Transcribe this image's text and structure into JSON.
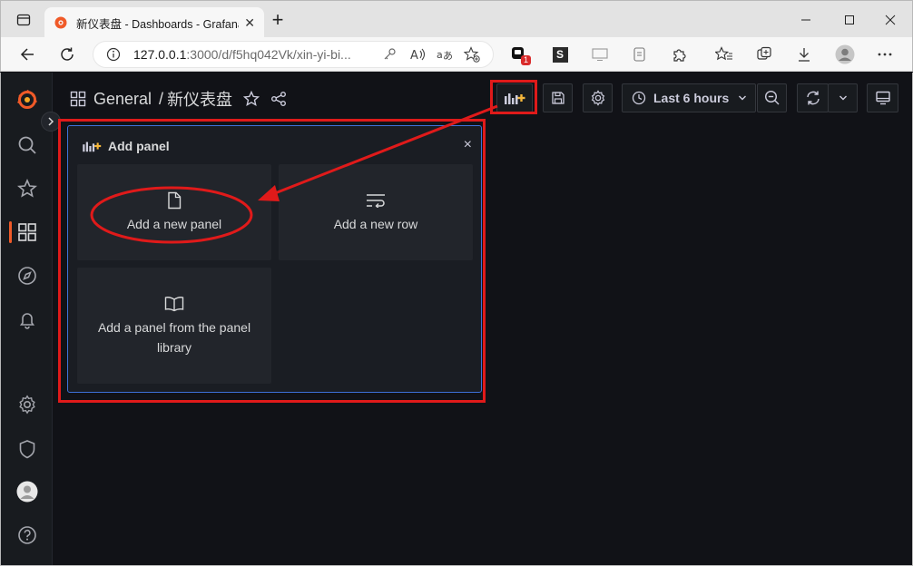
{
  "browser": {
    "tab_title": "新仪表盘 - Dashboards - Grafana",
    "tab_close": "✕",
    "new_tab": "+",
    "url_host": "127.0.0.1",
    "url_rest": ":3000/d/f5hq042Vk/xin-yi-bi...",
    "extension_badge": "1",
    "ext_s_label": "S"
  },
  "breadcrumb": {
    "folder": "General",
    "separator": "/",
    "dashboard": "新仪表盘"
  },
  "toolbar": {
    "time_range": "Last 6 hours"
  },
  "add_panel": {
    "title": "Add panel",
    "close": "×",
    "options": [
      {
        "label": "Add a new panel"
      },
      {
        "label": "Add a new row"
      },
      {
        "label": "Add a panel from the panel library"
      }
    ]
  },
  "colors": {
    "accent": "#f05a28",
    "annotation": "#e01a1a",
    "selected_border": "#3d71d9",
    "plus_yellow": "#f5b73b"
  }
}
